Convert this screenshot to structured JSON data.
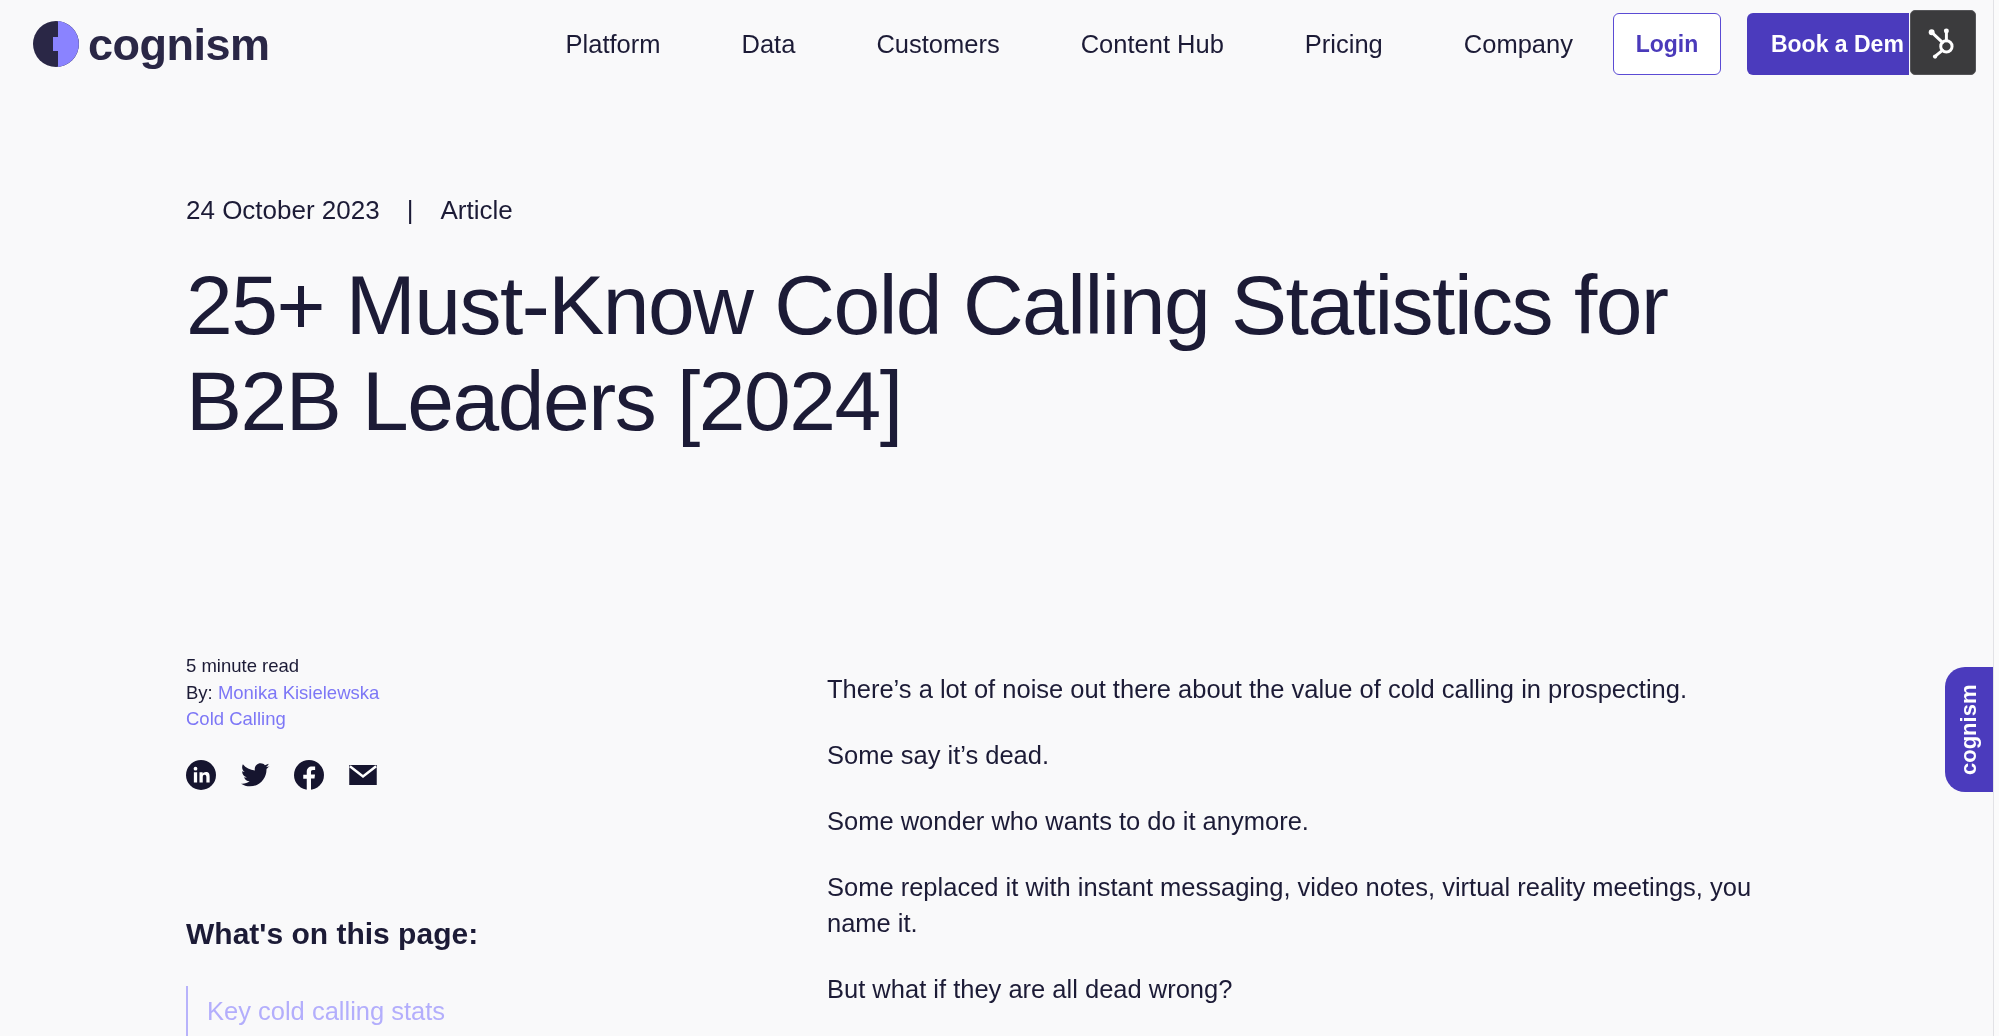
{
  "header": {
    "logo": {
      "wordmark": "cognism"
    },
    "nav": [
      "Platform",
      "Data",
      "Customers",
      "Content Hub",
      "Pricing",
      "Company"
    ],
    "login_button": "Login",
    "demo_button": "Book a Dem"
  },
  "article": {
    "date": "24 October 2023",
    "separator": "|",
    "type": "Article",
    "title": "25+ Must-Know Cold Calling Statistics for B2B Leaders [2024]",
    "read_time": "5 minute read",
    "byline": {
      "prefix": "By:",
      "author": "Monika Kisielewska"
    },
    "category": "Cold Calling",
    "toc": {
      "heading": "What's on this page:",
      "items": [
        "Key cold calling stats"
      ]
    },
    "paragraphs": [
      "There’s a lot of noise out there about the value of cold calling in prospecting.",
      "Some say it’s dead.",
      "Some wonder who wants to do it anymore.",
      "Some replaced it with instant messaging, video notes, virtual reality meetings, you name it.",
      "But what if they are all dead wrong?"
    ]
  },
  "side_tab": {
    "label": "cognism"
  }
}
